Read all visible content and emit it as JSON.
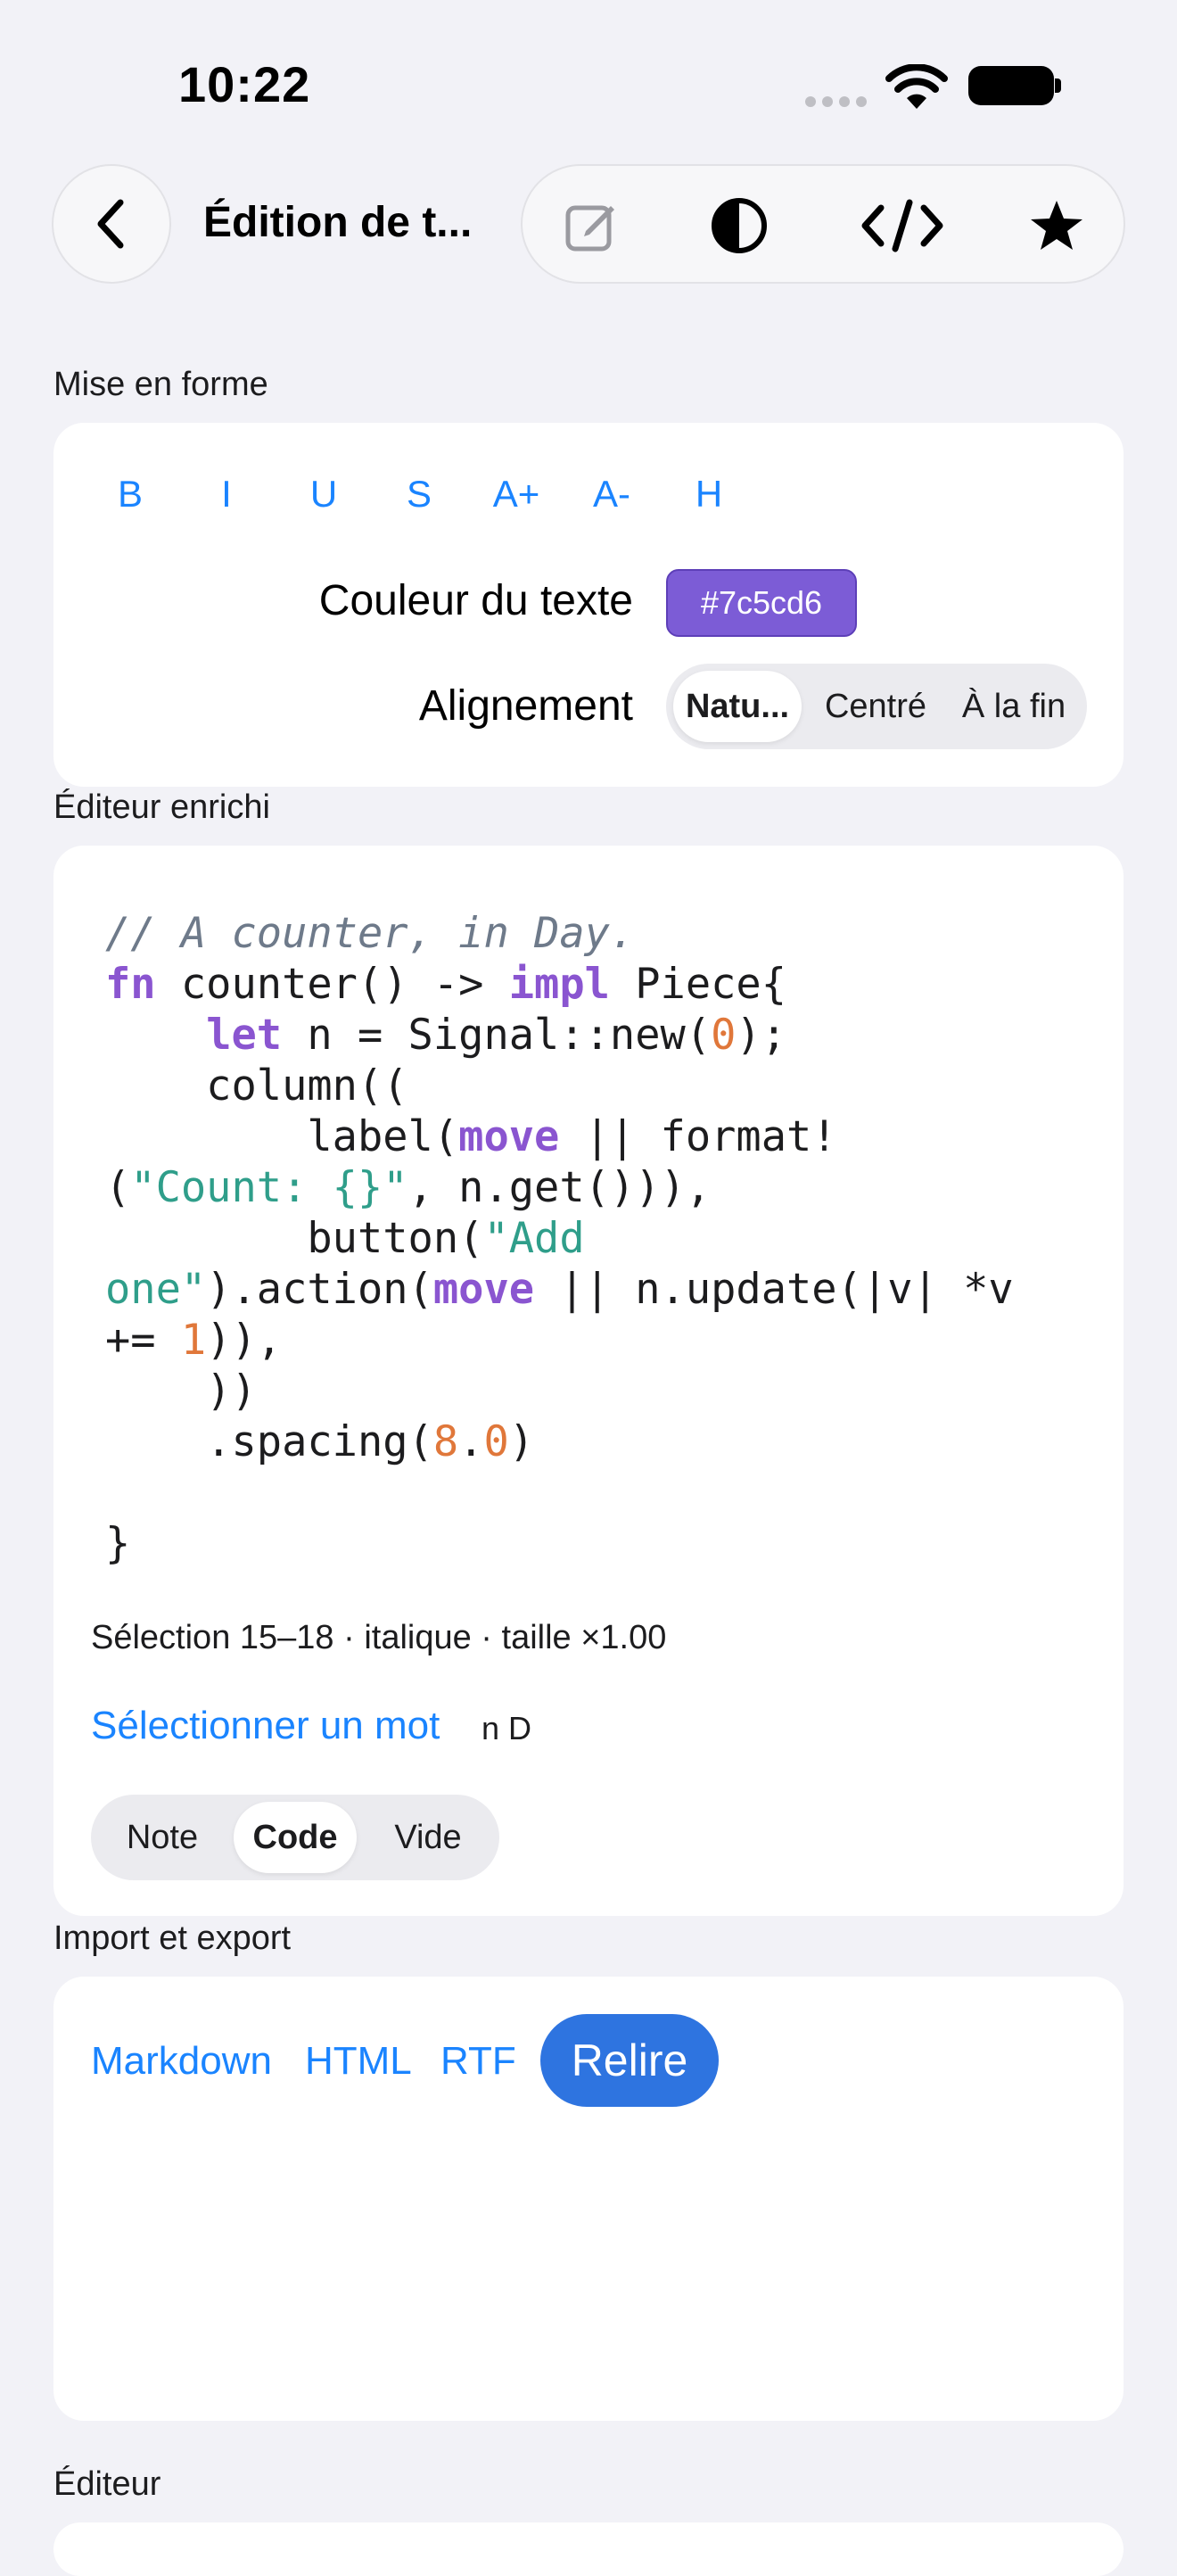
{
  "status_bar": {
    "time": "10:22"
  },
  "nav": {
    "title": "Édition de t...",
    "toolbar_icons": [
      "compose-icon",
      "contrast-icon",
      "code-icon",
      "star-icon"
    ]
  },
  "formatting": {
    "section_title": "Mise en forme",
    "buttons": [
      "B",
      "I",
      "U",
      "S",
      "A+",
      "A-",
      "H"
    ],
    "text_color_label": "Couleur du texte",
    "text_color_value": "#7c5cd6",
    "alignment_label": "Alignement",
    "alignment_options": [
      "Natu...",
      "Centré",
      "À la fin"
    ],
    "alignment_selected": "Natu..."
  },
  "rich_editor": {
    "section_title": "Éditeur enrichi",
    "code_lines": [
      "// A counter, in Day.",
      "fn counter() -> impl Piece{",
      "    let n = Signal::new(0);",
      "    column((",
      "        label(move || format!",
      "(\"Count: {}\", n.get())),",
      "        button(\"Add",
      "one\").action(move || n.update(|v| *v",
      "+= 1)),",
      "    ))",
      "    .spacing(8.0)",
      "",
      "}"
    ],
    "selection_info": "Sélection 15–18 · italique · taille ×1.00",
    "select_word_label": "Sélectionner un mot",
    "selected_word": "n D",
    "mode_options": [
      "Note",
      "Code",
      "Vide"
    ],
    "mode_selected": "Code"
  },
  "import_export": {
    "section_title": "Import et export",
    "links": [
      "Markdown",
      "HTML",
      "RTF"
    ],
    "primary_button": "Relire"
  },
  "editor": {
    "section_title": "Éditeur"
  },
  "colors": {
    "accent": "#1a84ff",
    "primary_button": "#2e74e0",
    "chip": "#7c5cd6"
  }
}
